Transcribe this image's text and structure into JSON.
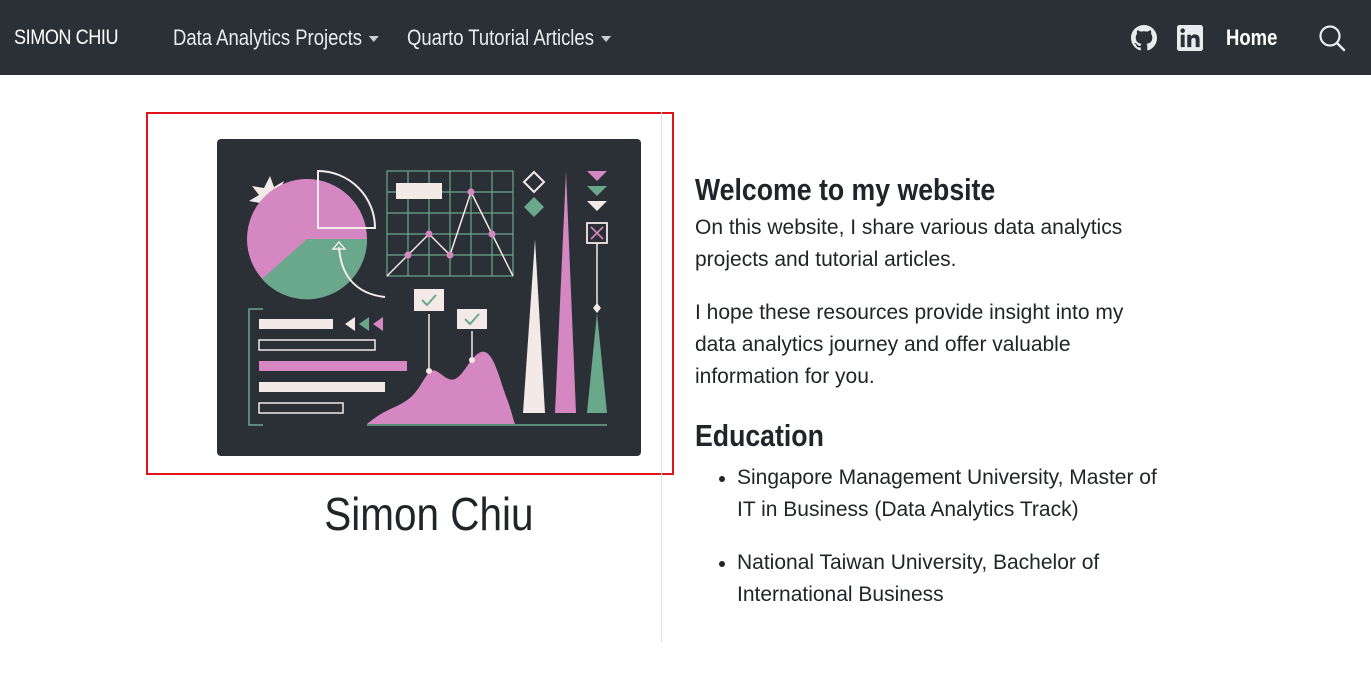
{
  "navbar": {
    "brand": "SIMON CHIU",
    "menus": [
      {
        "label": "Data Analytics Projects"
      },
      {
        "label": "Quarto Tutorial Articles"
      }
    ],
    "icons": [
      "github-icon",
      "linkedin-icon",
      "search-icon"
    ],
    "home_label": "Home"
  },
  "profile": {
    "name": "Simon Chiu"
  },
  "welcome": {
    "heading": "Welcome to my website",
    "paragraph1": "On this website, I share various data analytics projects and tutorial articles.",
    "paragraph2": "I hope these resources provide insight into my data analytics journey and offer valuable information for you."
  },
  "education": {
    "heading": "Education",
    "items": [
      "Singapore Management University, Master of IT in Business (Data Analytics Track)",
      "National Taiwan University, Bachelor of International Business"
    ]
  },
  "colors": {
    "navbar_bg": "#2b3036",
    "highlight_border": "#e0141a",
    "illustration_pink": "#d487c0",
    "illustration_green": "#6aa88c",
    "illustration_cream": "#f3e9e7"
  }
}
